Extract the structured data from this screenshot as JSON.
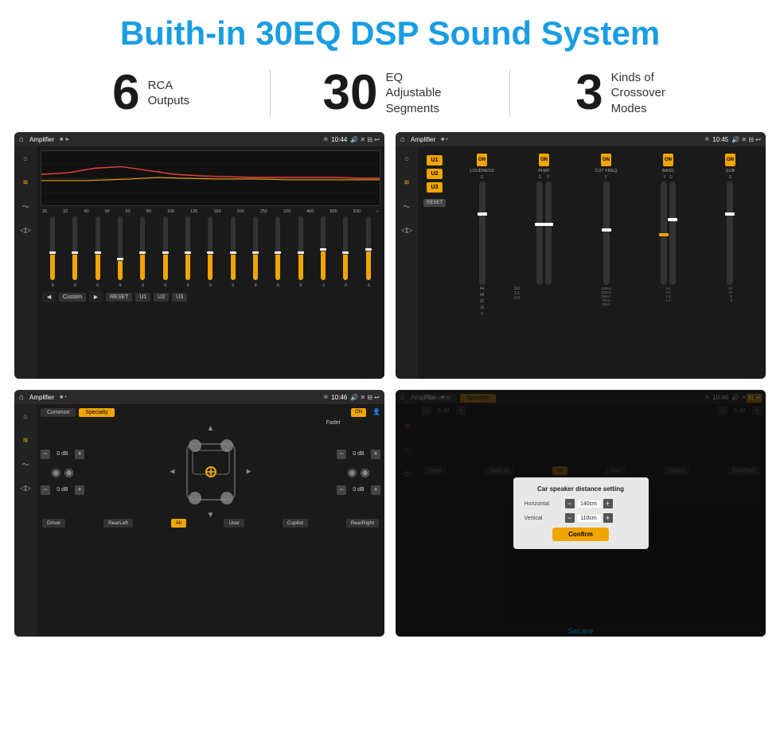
{
  "header": {
    "title": "Buith-in 30EQ DSP Sound System"
  },
  "stats": [
    {
      "number": "6",
      "text": "RCA\nOutputs"
    },
    {
      "number": "30",
      "text": "EQ Adjustable\nSegments"
    },
    {
      "number": "3",
      "text": "Kinds of\nCrossover Modes"
    }
  ],
  "screens": [
    {
      "id": "screen1",
      "statusBar": {
        "title": "Amplifier",
        "time": "10:44"
      },
      "type": "equalizer"
    },
    {
      "id": "screen2",
      "statusBar": {
        "title": "Amplifier",
        "time": "10:45"
      },
      "type": "amplifier"
    },
    {
      "id": "screen3",
      "statusBar": {
        "title": "Amplifier",
        "time": "10:46"
      },
      "type": "fader"
    },
    {
      "id": "screen4",
      "statusBar": {
        "title": "Amplifier",
        "time": "10:46"
      },
      "type": "fader-dialog"
    }
  ],
  "equalizer": {
    "frequencies": [
      "25",
      "32",
      "40",
      "50",
      "63",
      "80",
      "100",
      "125",
      "160",
      "200",
      "250",
      "320",
      "400",
      "500",
      "630"
    ],
    "values": [
      "0",
      "0",
      "0",
      "5",
      "0",
      "0",
      "0",
      "0",
      "0",
      "0",
      "0",
      "0",
      "-1",
      "0",
      "-1"
    ],
    "presets": [
      "Custom",
      "RESET",
      "U1",
      "U2",
      "U3"
    ]
  },
  "amplifier": {
    "presets": [
      "U1",
      "U2",
      "U3"
    ],
    "channels": [
      {
        "label": "LOUDNESS",
        "state": "ON"
      },
      {
        "label": "PHAT",
        "state": "ON"
      },
      {
        "label": "CUT FREQ",
        "state": "ON"
      },
      {
        "label": "BASS",
        "state": "ON"
      },
      {
        "label": "SUB",
        "state": "ON"
      }
    ],
    "resetLabel": "RESET"
  },
  "fader": {
    "tabs": [
      "Common",
      "Specialty"
    ],
    "activeTab": "Specialty",
    "faderLabel": "Fader",
    "faderState": "ON",
    "dbValues": [
      "0 dB",
      "0 dB",
      "0 dB",
      "0 dB"
    ],
    "positions": [
      "Driver",
      "RearLeft",
      "All",
      "User",
      "Copilot",
      "RearRight"
    ]
  },
  "dialog": {
    "title": "Car speaker distance setting",
    "horizontal": {
      "label": "Horizontal",
      "value": "140cm"
    },
    "vertical": {
      "label": "Vertical",
      "value": "110cm"
    },
    "confirmLabel": "Confirm"
  },
  "watermark": "Seicane"
}
